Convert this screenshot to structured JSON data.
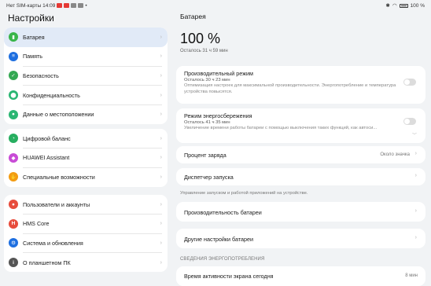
{
  "status_bar": {
    "left_text": "Нет SIM-карты 14:09",
    "battery_text": "100 %"
  },
  "left_pane": {
    "title": "Настройки",
    "group1": [
      {
        "label": "Батарея",
        "icon": "battery-icon",
        "color": "#39b54a"
      },
      {
        "label": "Память",
        "icon": "storage-icon",
        "color": "#1e6fe0"
      },
      {
        "label": "Безопасность",
        "icon": "security-icon",
        "color": "#34a853"
      },
      {
        "label": "Конфиденциальность",
        "icon": "privacy-icon",
        "color": "#2bb673"
      },
      {
        "label": "Данные о местоположении",
        "icon": "location-icon",
        "color": "#2bb673"
      }
    ],
    "group2": [
      {
        "label": "Цифровой баланс",
        "icon": "digital-balance-icon",
        "color": "#27ae60"
      },
      {
        "label": "HUAWEI Assistant",
        "icon": "assistant-icon",
        "color": "#c84bd6"
      },
      {
        "label": "Специальные возможности",
        "icon": "accessibility-icon",
        "color": "#f39c12"
      }
    ],
    "group3": [
      {
        "label": "Пользователи и аккаунты",
        "icon": "user-icon",
        "color": "#e74c3c"
      },
      {
        "label": "HMS Core",
        "icon": "hms-icon",
        "color": "#e74c3c"
      },
      {
        "label": "Система и обновления",
        "icon": "system-icon",
        "color": "#1e6fe0"
      },
      {
        "label": "О планшетном ПК",
        "icon": "info-icon",
        "color": "#555555"
      }
    ]
  },
  "right_pane": {
    "title": "Батарея",
    "percent": "100 %",
    "remaining": "Осталось 31 ч 59 мин",
    "performance_mode": {
      "title": "Производительный режим",
      "remaining": "Осталось 30 ч 23 мин",
      "desc": "Оптимизация настроек для максимальной производительности. Энергопотребление и температура устройства повысятся."
    },
    "power_saving": {
      "title": "Режим энергосбережения",
      "remaining": "Осталось 41 ч 35 мин",
      "desc": "Увеличение времени работы батареи с помощью выключения таких функций, как автоси..."
    },
    "charge_percent": {
      "title": "Процент заряда",
      "value": "Около значка"
    },
    "launch_manager": {
      "title": "Диспетчер запуска",
      "hint": "Управление запуском и работой приложений на устройстве."
    },
    "battery_performance": {
      "title": "Производительность батареи"
    },
    "other_settings": {
      "title": "Другие настройки батареи"
    },
    "section_label": "СВЕДЕНИЯ ЭНЕРГОПОТРЕБЛЕНИЯ",
    "screen_time": {
      "title": "Время активности экрана сегодня",
      "value": "8 мин"
    }
  }
}
